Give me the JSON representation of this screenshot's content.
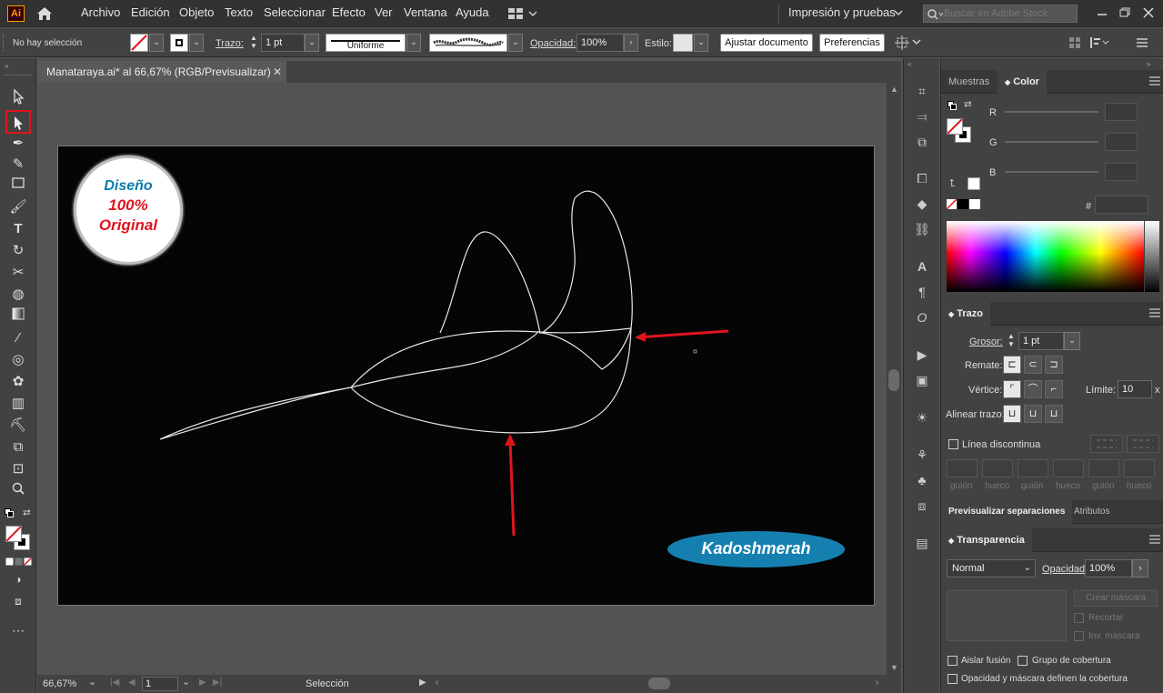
{
  "app": {
    "logo": "Ai"
  },
  "menu": [
    "Archivo",
    "Edición",
    "Objeto",
    "Texto",
    "Seleccionar",
    "Efecto",
    "Ver",
    "Ventana",
    "Ayuda"
  ],
  "workspace": "Impresión y pruebas",
  "search": {
    "placeholder": "Buscar en Adobe Stock"
  },
  "control": {
    "selection_state": "No hay selección",
    "stroke_label": "Trazo:",
    "stroke_weight": "1 pt",
    "profile": "Uniforme",
    "opacity_label": "Opacidad:",
    "opacity_value": "100%",
    "style_label": "Estilo:",
    "fit_button": "Ajustar documento",
    "prefs_button": "Preferencias"
  },
  "document": {
    "tab_title": "Manataraya.ai* al 66,67% (RGB/Previsualizar)"
  },
  "artwork": {
    "badge": {
      "line1": "Diseño",
      "line2": "100%",
      "line3": "Original"
    },
    "signature": "Kadoshmerah"
  },
  "status": {
    "zoom": "66,67%",
    "artboard": "1",
    "tool": "Selección"
  },
  "colors": {
    "accent_red": "#e0141e",
    "badge_blue": "#0a7cab",
    "signature_blue": "#1580b0"
  },
  "panels": {
    "color_tabs": [
      "Muestras",
      "Color"
    ],
    "color_labels": {
      "r": "R",
      "g": "G",
      "b": "B",
      "hash": "#"
    },
    "stroke": {
      "title": "Trazo",
      "weight_label": "Grosor:",
      "weight_value": "1 pt",
      "cap_label": "Remate:",
      "corner_label": "Vértice:",
      "limit_label": "Límite:",
      "limit_value": "10",
      "limit_suffix": "x",
      "align_label": "Alinear trazo:",
      "dashed_label": "Línea discontinua",
      "dash_fields": [
        "guión",
        "hueco",
        "guión",
        "hueco",
        "guión",
        "hueco"
      ]
    },
    "preview_tabs": [
      "Previsualizar separaciones",
      "Atributos"
    ],
    "transparency": {
      "title": "Transparencia",
      "blend_mode": "Normal",
      "opacity_label": "Opacidad:",
      "opacity_value": "100%",
      "make_mask": "Crear máscara",
      "clip": "Recortar",
      "invert": "Inv. máscara",
      "isolate": "Aislar fusión",
      "knockout": "Grupo de cobertura",
      "opacity_mask": "Opacidad y máscara definen la cobertura"
    }
  }
}
